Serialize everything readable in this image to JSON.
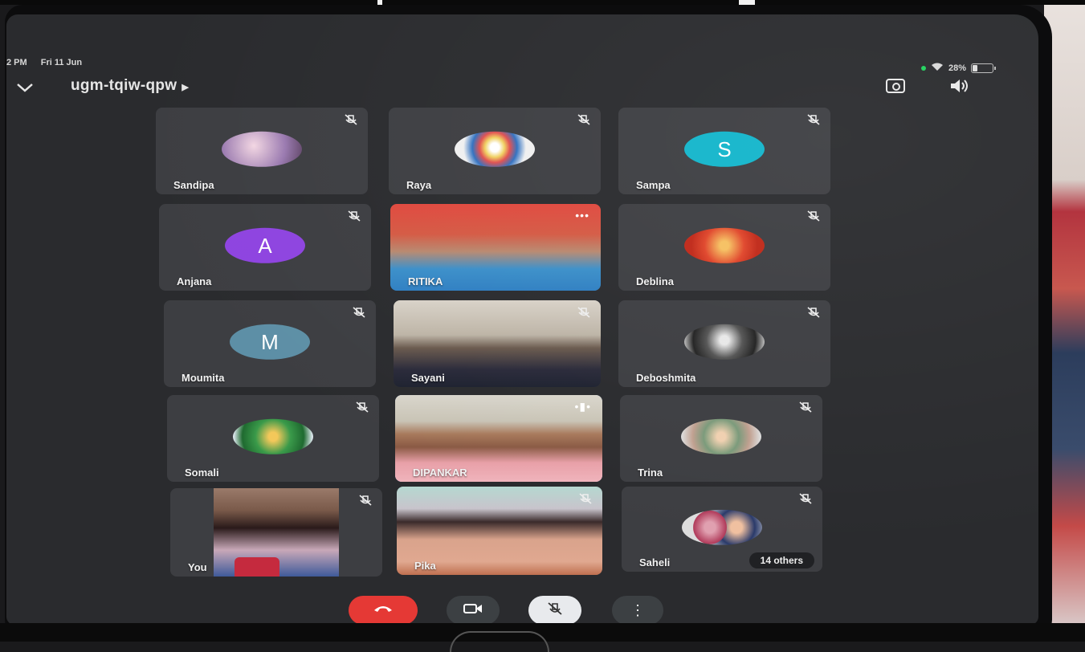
{
  "status_bar": {
    "time": "2 PM",
    "date": "Fri 11 Jun",
    "battery": "28%"
  },
  "header": {
    "meeting_code": "ugm-tqiw-qpw"
  },
  "participants": [
    {
      "name": "Sandipa",
      "muted": true,
      "tile": "photo"
    },
    {
      "name": "Raya",
      "muted": true,
      "tile": "photo"
    },
    {
      "name": "Sampa",
      "muted": true,
      "tile": "initial",
      "initial": "S",
      "color": "#12b5cb"
    },
    {
      "name": "Anjana",
      "muted": true,
      "tile": "initial",
      "initial": "A",
      "color": "#8e44e0"
    },
    {
      "name": "RITIKA",
      "muted": false,
      "tile": "video"
    },
    {
      "name": "Deblina",
      "muted": true,
      "tile": "photo"
    },
    {
      "name": "Moumita",
      "muted": true,
      "tile": "initial",
      "initial": "M",
      "color": "#5d8fa6"
    },
    {
      "name": "Sayani",
      "muted": true,
      "tile": "video"
    },
    {
      "name": "Deboshmita",
      "muted": true,
      "tile": "photo"
    },
    {
      "name": "Somali",
      "muted": true,
      "tile": "photo"
    },
    {
      "name": "DIPANKAR",
      "muted": false,
      "tile": "video",
      "speaking": true
    },
    {
      "name": "Trina",
      "muted": true,
      "tile": "photo"
    },
    {
      "name": "You",
      "muted": true,
      "tile": "video"
    },
    {
      "name": "Pika",
      "muted": true,
      "tile": "video"
    },
    {
      "name": "Saheli",
      "muted": true,
      "tile": "photo",
      "others_label": "14 others"
    }
  ],
  "controls": {
    "end_call_color": "#e53935",
    "more_label": "⋮"
  }
}
